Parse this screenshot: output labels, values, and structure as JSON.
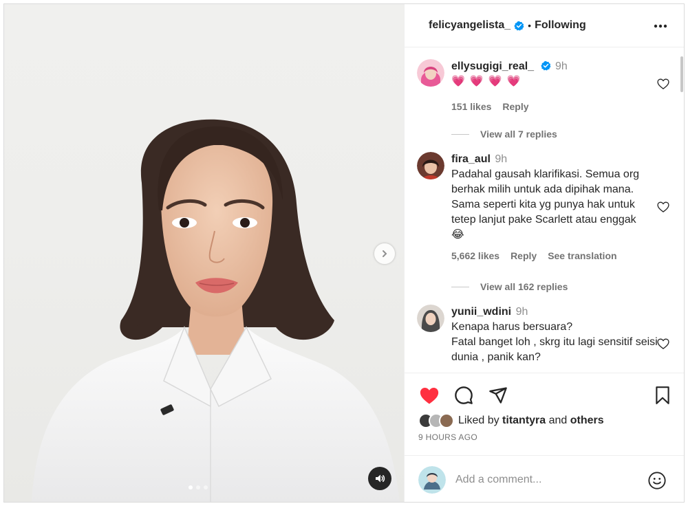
{
  "post": {
    "author": "felicyangelista_",
    "separator": "•",
    "follow_state": "Following",
    "verified": true
  },
  "carousel": {
    "slide_count": 3,
    "active_slide": 1
  },
  "comments": [
    {
      "username": "ellysugigi_real_",
      "verified": true,
      "time": "9h",
      "text": "",
      "emoji": [
        "💗",
        "💗",
        "💗",
        "💗"
      ],
      "likes": "151 likes",
      "reply": "Reply",
      "view_replies": "View all 7 replies"
    },
    {
      "username": "fira_aul",
      "verified": false,
      "time": "9h",
      "text": "Padahal gausah klarifikasi. Semua org berhak milih untuk ada dipihak mana. Sama seperti kita yg punya hak untuk tetep lanjut pake Scarlett atau enggak",
      "emoji_line": "😂",
      "likes": "5,662 likes",
      "reply": "Reply",
      "translate": "See translation",
      "view_replies": "View all 162 replies"
    },
    {
      "username": "yunii_wdini",
      "verified": false,
      "time": "9h",
      "text": "Kenapa harus bersuara?\nFatal banget loh , skrg itu lagi sensitif seisi dunia , panik kan?"
    }
  ],
  "actions": {
    "liked_prefix": "Liked by",
    "liked_user": "titantyra",
    "liked_and": "and",
    "liked_others": "others",
    "time_ago": "9 HOURS AGO"
  },
  "comment_box": {
    "placeholder": "Add a comment..."
  },
  "colors": {
    "like_red": "#ff3040",
    "verified_blue": "#0095f6",
    "muted_text": "#737373"
  }
}
